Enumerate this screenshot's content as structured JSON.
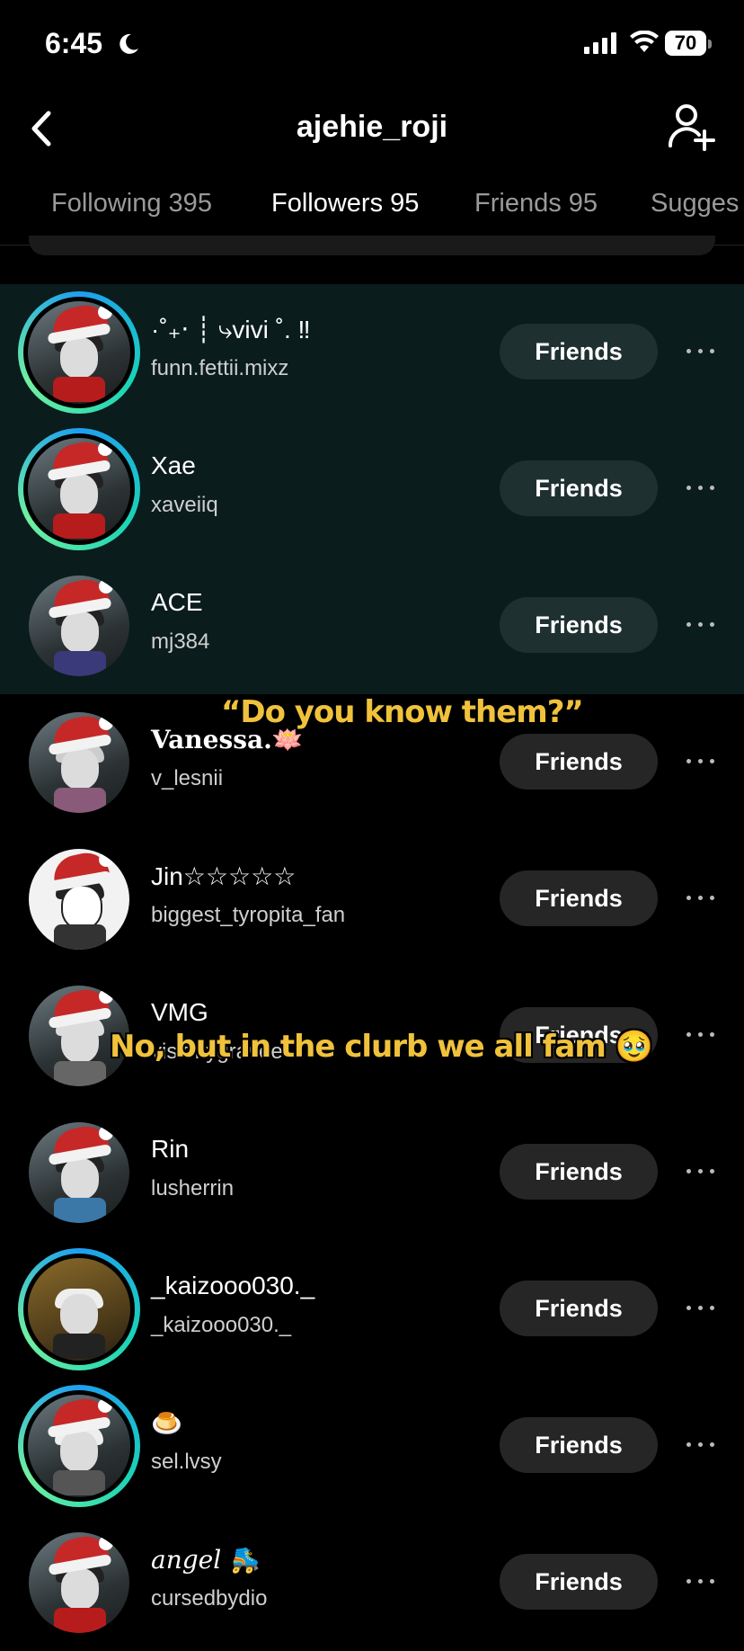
{
  "status_bar": {
    "time": "6:45",
    "battery": "70"
  },
  "header": {
    "title": "ajehie_roji"
  },
  "tabs": [
    {
      "label": "Following 395"
    },
    {
      "label": "Followers 95"
    },
    {
      "label": "Friends 95"
    },
    {
      "label": "Sugges"
    }
  ],
  "rows": [
    {
      "name": "·˚₊‧ ┊ ⤷vivi ˚. ‼",
      "handle": "funn.fettii.mixz",
      "button": "Friends"
    },
    {
      "name": "Xae",
      "handle": "xaveiiq",
      "button": "Friends"
    },
    {
      "name": "ACE",
      "handle": "mj384",
      "button": "Friends"
    },
    {
      "name": "Vanessa.🪷",
      "handle": "v_lesnii",
      "button": "Friends"
    },
    {
      "name": "Jin☆☆☆☆☆",
      "handle": "biggest_tyropita_fan",
      "button": "Friends"
    },
    {
      "name": "VMG",
      "handle": "visitmygravee",
      "button": "Friends"
    },
    {
      "name": "Rin",
      "handle": "lusherrin",
      "button": "Friends"
    },
    {
      "name": "_kaizooo030._",
      "handle": "_kaizooo030._",
      "button": "Friends"
    },
    {
      "name": "🍮",
      "handle": "sel.lvsy",
      "button": "Friends"
    },
    {
      "name": "angel 🛼",
      "handle": "cursedbydio",
      "button": "Friends"
    }
  ],
  "captions": {
    "top": "“Do you know them?”",
    "bottom": "No, but in the clurb we all fam 🥹"
  },
  "colors": {
    "accent_ring": "#19d3b8",
    "caption": "#f0c23b",
    "suggested_bg": "#0b1c1d"
  }
}
